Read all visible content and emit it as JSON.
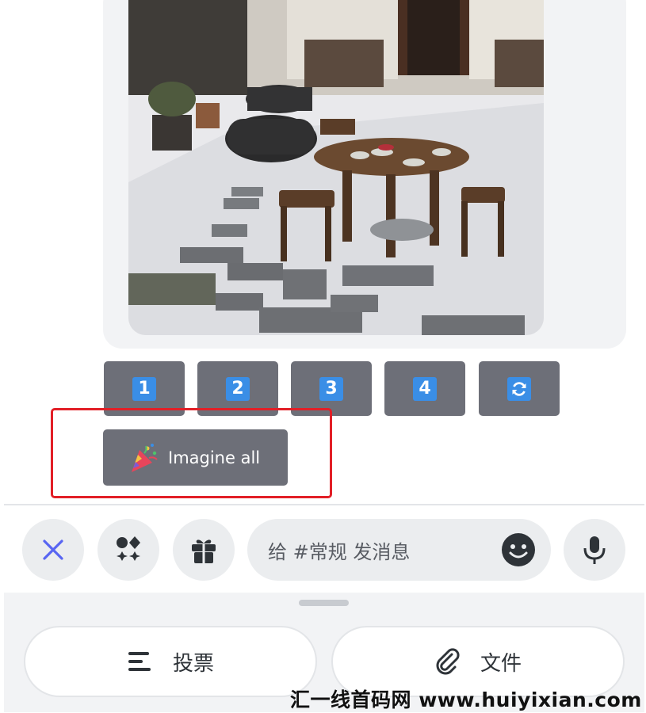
{
  "attachment": {
    "image_alt": "courtyard with round wooden table and stools in snow"
  },
  "variation_buttons": [
    {
      "label": "1"
    },
    {
      "label": "2"
    },
    {
      "label": "3"
    },
    {
      "label": "4"
    }
  ],
  "reroll_icon": "refresh-icon",
  "imagine_all": {
    "label": "Imagine all",
    "icon": "party-popper-icon"
  },
  "composer": {
    "close_icon": "close-icon",
    "apps_icon": "apps-icon",
    "gift_icon": "gift-icon",
    "placeholder": "给 #常规 发消息",
    "emoji_icon": "emoji-icon",
    "mic_icon": "microphone-icon"
  },
  "bottom_panel": {
    "poll_label": "投票",
    "poll_icon": "poll-icon",
    "file_label": "文件",
    "file_icon": "paperclip-icon"
  },
  "watermark": "汇一线首码网 www.huiyixian.com",
  "colors": {
    "button_gray": "#6d6f78",
    "number_blue": "#3a8ee6",
    "highlight_red": "#e21f27",
    "accent_blurple": "#5865f2"
  }
}
